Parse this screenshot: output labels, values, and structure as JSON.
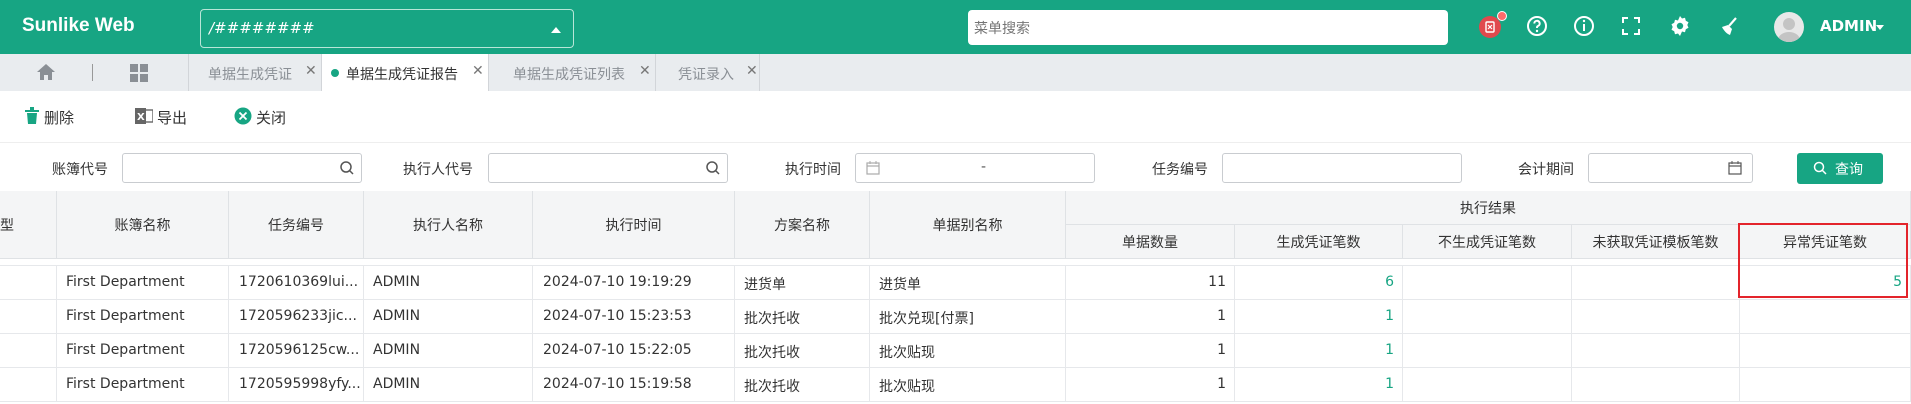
{
  "app": {
    "brand": "Sunlike Web"
  },
  "topbar": {
    "org_value": "/########",
    "search_placeholder": "菜单搜索",
    "user": "ADMIN"
  },
  "tabs": [
    {
      "label": "单据生成凭证",
      "active": false
    },
    {
      "label": "单据生成凭证报告",
      "active": true
    },
    {
      "label": "单据生成凭证列表",
      "active": false
    },
    {
      "label": "凭证录入",
      "active": false
    }
  ],
  "toolbar": {
    "delete": "删除",
    "export": "导出",
    "close": "关闭"
  },
  "filters": {
    "ledger_code": "账簿代号",
    "executor_code": "执行人代号",
    "exec_time": "执行时间",
    "date_range_sep": "-",
    "task_no": "任务编号",
    "period": "会计期间",
    "query": "查询"
  },
  "table": {
    "headers": {
      "type_partial": "型",
      "ledger_name": "账簿名称",
      "task_no": "任务编号",
      "executor": "执行人名称",
      "exec_time": "执行时间",
      "scheme": "方案名称",
      "bill_alias": "单据别名称",
      "result_group": "执行结果",
      "bill_count": "单据数量",
      "gen_count": "生成凭证笔数",
      "not_gen_count": "不生成凭证笔数",
      "no_template_count": "未获取凭证模板笔数",
      "abnormal_count": "异常凭证笔数"
    },
    "rows": [
      {
        "ledger": "First Department",
        "task": "1720610369lui...",
        "executor": "ADMIN",
        "time": "2024-07-10 19:19:29",
        "scheme": "进货单",
        "alias": "进货单",
        "bills": "11",
        "gen": "6",
        "not_gen": "",
        "no_tpl": "",
        "abnormal": "5"
      },
      {
        "ledger": "First Department",
        "task": "1720596233jic...",
        "executor": "ADMIN",
        "time": "2024-07-10 15:23:53",
        "scheme": "批次托收",
        "alias": "批次兑现[付票]",
        "bills": "1",
        "gen": "1",
        "not_gen": "",
        "no_tpl": "",
        "abnormal": ""
      },
      {
        "ledger": "First Department",
        "task": "1720596125cw...",
        "executor": "ADMIN",
        "time": "2024-07-10 15:22:05",
        "scheme": "批次托收",
        "alias": "批次贴现",
        "bills": "1",
        "gen": "1",
        "not_gen": "",
        "no_tpl": "",
        "abnormal": ""
      },
      {
        "ledger": "First Department",
        "task": "1720595998yfy...",
        "executor": "ADMIN",
        "time": "2024-07-10 15:19:58",
        "scheme": "批次托收",
        "alias": "批次贴现",
        "bills": "1",
        "gen": "1",
        "not_gen": "",
        "no_tpl": "",
        "abnormal": ""
      }
    ]
  },
  "colors": {
    "brand_green": "#17a583",
    "highlight_red": "#e3242b",
    "badge_red": "#e0494d"
  }
}
